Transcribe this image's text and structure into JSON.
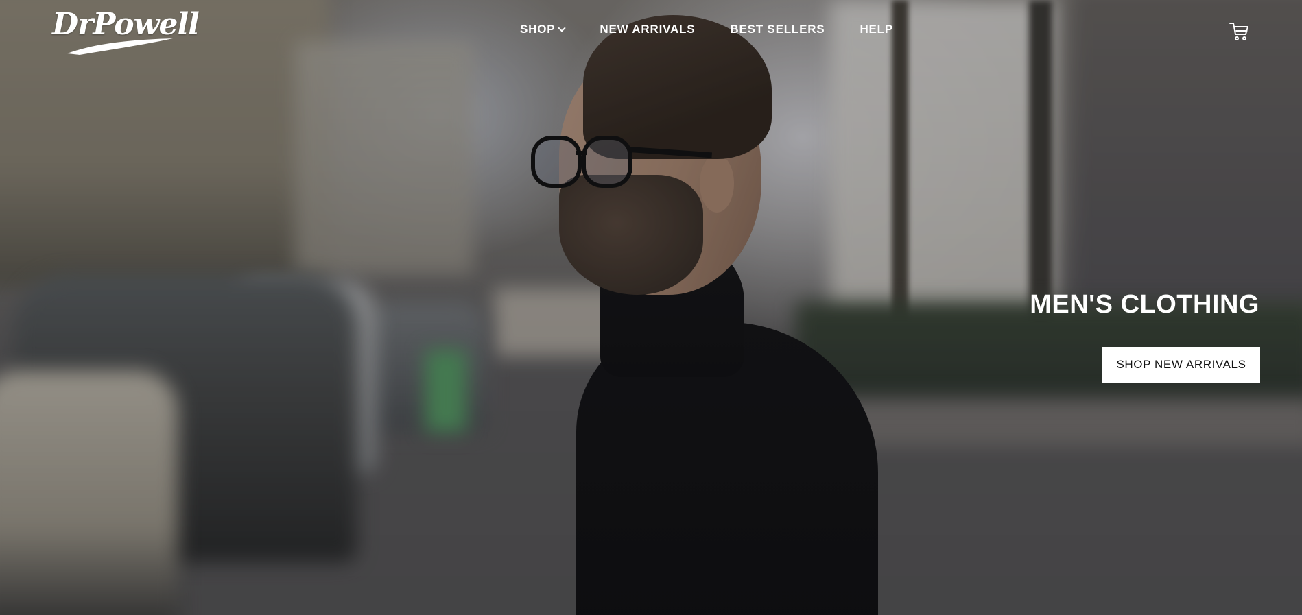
{
  "brand": {
    "logo_text": "DrPowell"
  },
  "nav": {
    "items": [
      {
        "label": "SHOP",
        "has_dropdown": true
      },
      {
        "label": "NEW ARRIVALS",
        "has_dropdown": false
      },
      {
        "label": "BEST SELLERS",
        "has_dropdown": false
      },
      {
        "label": "HELP",
        "has_dropdown": false
      }
    ],
    "cart_icon": "shopping-cart-icon"
  },
  "hero": {
    "title": "MEN'S CLOTHING",
    "cta_label": "SHOP NEW ARRIVALS",
    "image_subject": "man in black turtleneck and glasses on a city street"
  },
  "colors": {
    "text": "#ffffff",
    "cta_background": "#ffffff",
    "cta_text": "#111111"
  }
}
